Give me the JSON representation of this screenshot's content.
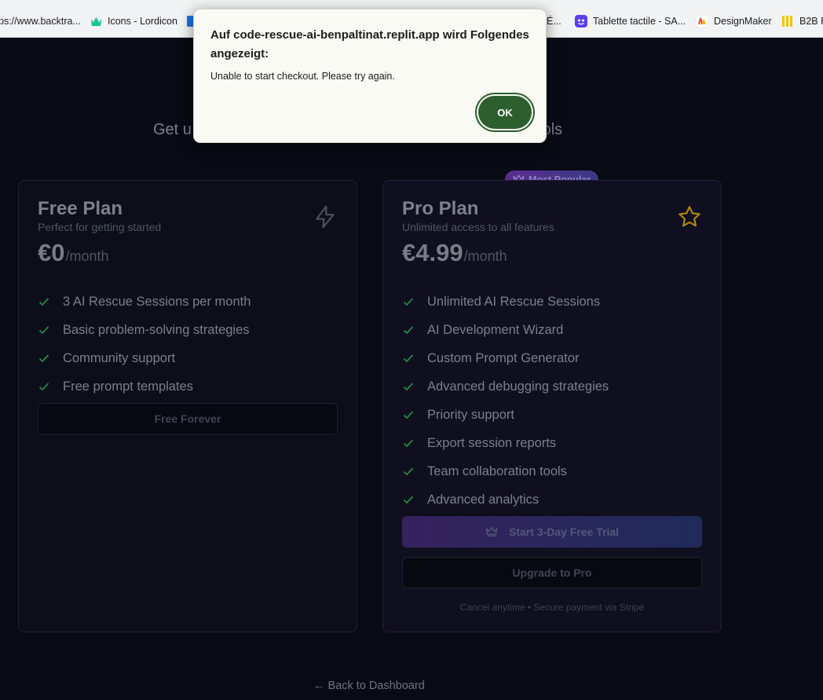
{
  "bookmarks": [
    {
      "label": "ps://www.backtra...",
      "icon": "none"
    },
    {
      "label": "Icons - Lordicon",
      "icon": "lordicon-icon"
    },
    {
      "label": "É...",
      "icon": "none"
    },
    {
      "label": "Tablette tactile - SA...",
      "icon": "app-icon"
    },
    {
      "label": "DesignMaker",
      "icon": "designmaker-icon"
    },
    {
      "label": "B2B P",
      "icon": "bars-icon"
    }
  ],
  "page": {
    "subtitle_start": "Get u",
    "subtitle_end": "tools",
    "back_link": "← Back to Dashboard"
  },
  "plans": {
    "free": {
      "title": "Free Plan",
      "description": "Perfect for getting started",
      "price": "€0",
      "period": "/month",
      "features": [
        "3 AI Rescue Sessions per month",
        "Basic problem-solving strategies",
        "Community support",
        "Free prompt templates"
      ],
      "button": "Free Forever"
    },
    "pro": {
      "badge": "Most Popular",
      "title": "Pro Plan",
      "description": "Unlimited access to all features",
      "price": "€4.99",
      "period": "/month",
      "features": [
        "Unlimited AI Rescue Sessions",
        "AI Development Wizard",
        "Custom Prompt Generator",
        "Advanced debugging strategies",
        "Priority support",
        "Export session reports",
        "Team collaboration tools",
        "Advanced analytics"
      ],
      "trial_button": "Start 3-Day Free Trial",
      "upgrade_button": "Upgrade to Pro",
      "fine_print": "Cancel anytime • Secure payment via Stripe"
    }
  },
  "alert": {
    "title": "Auf code-rescue-ai-benpaltinat.replit.app wird Folgendes angezeigt:",
    "message": "Unable to start checkout. Please try again.",
    "ok_label": "OK"
  },
  "colors": {
    "background": "#080a14",
    "check": "#22c55e",
    "star": "#a8830f",
    "ok_button": "#2d5f2e"
  }
}
